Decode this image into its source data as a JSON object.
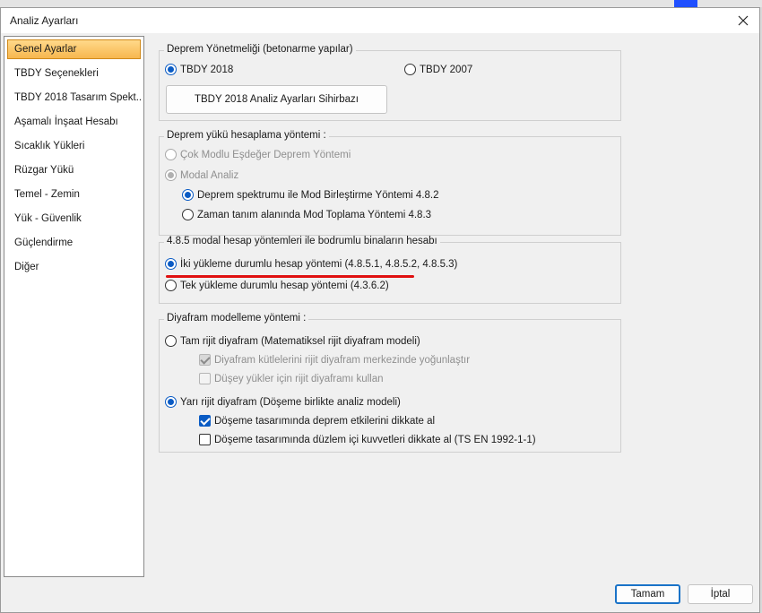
{
  "window": {
    "title": "Analiz Ayarları"
  },
  "sidebar": {
    "items": [
      {
        "label": "Genel Ayarlar",
        "selected": true
      },
      {
        "label": "TBDY Seçenekleri"
      },
      {
        "label": "TBDY 2018 Tasarım Spekt..."
      },
      {
        "label": "Aşamalı İnşaat Hesabı"
      },
      {
        "label": "Sıcaklık Yükleri"
      },
      {
        "label": "Rüzgar Yükü"
      },
      {
        "label": "Temel - Zemin"
      },
      {
        "label": "Yük - Güvenlik"
      },
      {
        "label": "Güçlendirme"
      },
      {
        "label": "Diğer"
      }
    ]
  },
  "regulation": {
    "title": "Deprem Yönetmeliği (betonarme yapılar)",
    "options": [
      {
        "label": "TBDY 2018",
        "checked": true
      },
      {
        "label": "TBDY 2007",
        "checked": false
      }
    ],
    "wizard_button": "TBDY 2018 Analiz Ayarları Sihirbazı"
  },
  "load_method": {
    "title": "Deprem yükü hesaplama yöntemi :",
    "options": [
      {
        "label": "Çok Modlu Eşdeğer Deprem Yöntemi",
        "checked": false,
        "enabled": false
      },
      {
        "label": "Modal Analiz",
        "checked": true,
        "enabled": false
      }
    ],
    "sub_options": [
      {
        "label": "Deprem spektrumu ile Mod Birleştirme Yöntemi 4.8.2",
        "checked": true
      },
      {
        "label": "Zaman tanım alanında Mod Toplama Yöntemi 4.8.3",
        "checked": false
      }
    ]
  },
  "basement": {
    "title": "4.8.5 modal hesap yöntemleri ile bodrumlu binaların hesabı",
    "options": [
      {
        "label": "İki yükleme durumlu hesap yöntemi (4.8.5.1, 4.8.5.2, 4.8.5.3)",
        "checked": true
      },
      {
        "label": "Tek yükleme durumlu hesap yöntemi (4.3.6.2)",
        "checked": false
      }
    ],
    "highlight_color": "#e01010"
  },
  "diaphragm": {
    "title": "Diyafram modelleme yöntemi  :",
    "rigid": {
      "label": "Tam rijit diyafram (Matematiksel rijit diyafram modeli)",
      "checked": false
    },
    "rigid_options": [
      {
        "label": "Diyafram kütlelerini rijit diyafram merkezinde yoğunlaştır",
        "checked": true,
        "enabled": false
      },
      {
        "label": "Düşey yükler için rijit diyaframı kullan",
        "checked": false,
        "enabled": false
      }
    ],
    "semi": {
      "label": "Yarı rijit diyafram (Döşeme birlikte analiz modeli)",
      "checked": true
    },
    "semi_options": [
      {
        "label": "Döşeme tasarımında deprem etkilerini dikkate al",
        "checked": true
      },
      {
        "label": "Döşeme tasarımında düzlem içi kuvvetleri dikkate al (TS EN 1992-1-1)",
        "checked": false
      }
    ]
  },
  "footer": {
    "ok_label": "Tamam",
    "cancel_label": "İptal"
  },
  "colors": {
    "accent": "#0a5bc4",
    "selected_item": "#f7b74e",
    "primary_border": "#1a73c8"
  }
}
